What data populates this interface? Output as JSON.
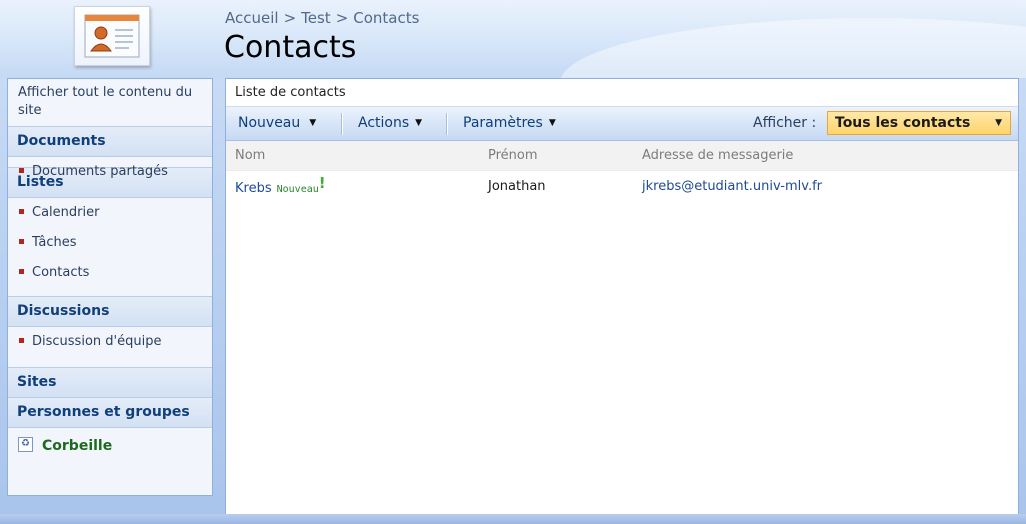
{
  "breadcrumb": {
    "items": [
      "Accueil",
      "Test",
      "Contacts"
    ],
    "separator": ">"
  },
  "page": {
    "title": "Contacts"
  },
  "nav": {
    "view_all": "Afficher tout le contenu du site",
    "documents": {
      "header": "Documents",
      "items": [
        "Documents partagés"
      ]
    },
    "lists": {
      "header": "Listes",
      "items": [
        "Calendrier",
        "Tâches",
        "Contacts"
      ]
    },
    "discussions": {
      "header": "Discussions",
      "items": [
        "Discussion d'équipe"
      ]
    },
    "sites": "Sites",
    "people": "Personnes et groupes",
    "recycle_bin": "Corbeille"
  },
  "list": {
    "title": "Liste de contacts",
    "toolbar": {
      "new": "Nouveau",
      "actions": "Actions",
      "settings": "Paramètres",
      "view_label": "Afficher :",
      "view_selected": "Tous les contacts"
    },
    "columns": [
      "Nom",
      "Prénom",
      "Adresse de messagerie"
    ],
    "rows": [
      {
        "nom": "Krebs",
        "badge": "Nouveau",
        "bang": "!",
        "prenom": "Jonathan",
        "email": "jkrebs@etudiant.univ-mlv.fr"
      }
    ]
  },
  "colors": {
    "accent_blue": "#103f7a",
    "link": "#1f4a94",
    "view_highlight": "#ffd46a",
    "recycle_green": "#1d6a1d",
    "bullet_red": "#b3261e"
  },
  "icons": {
    "logo": "contact-card-icon",
    "recycle": "recycle-bin-icon",
    "dropdown": "dropdown-arrow-icon"
  }
}
